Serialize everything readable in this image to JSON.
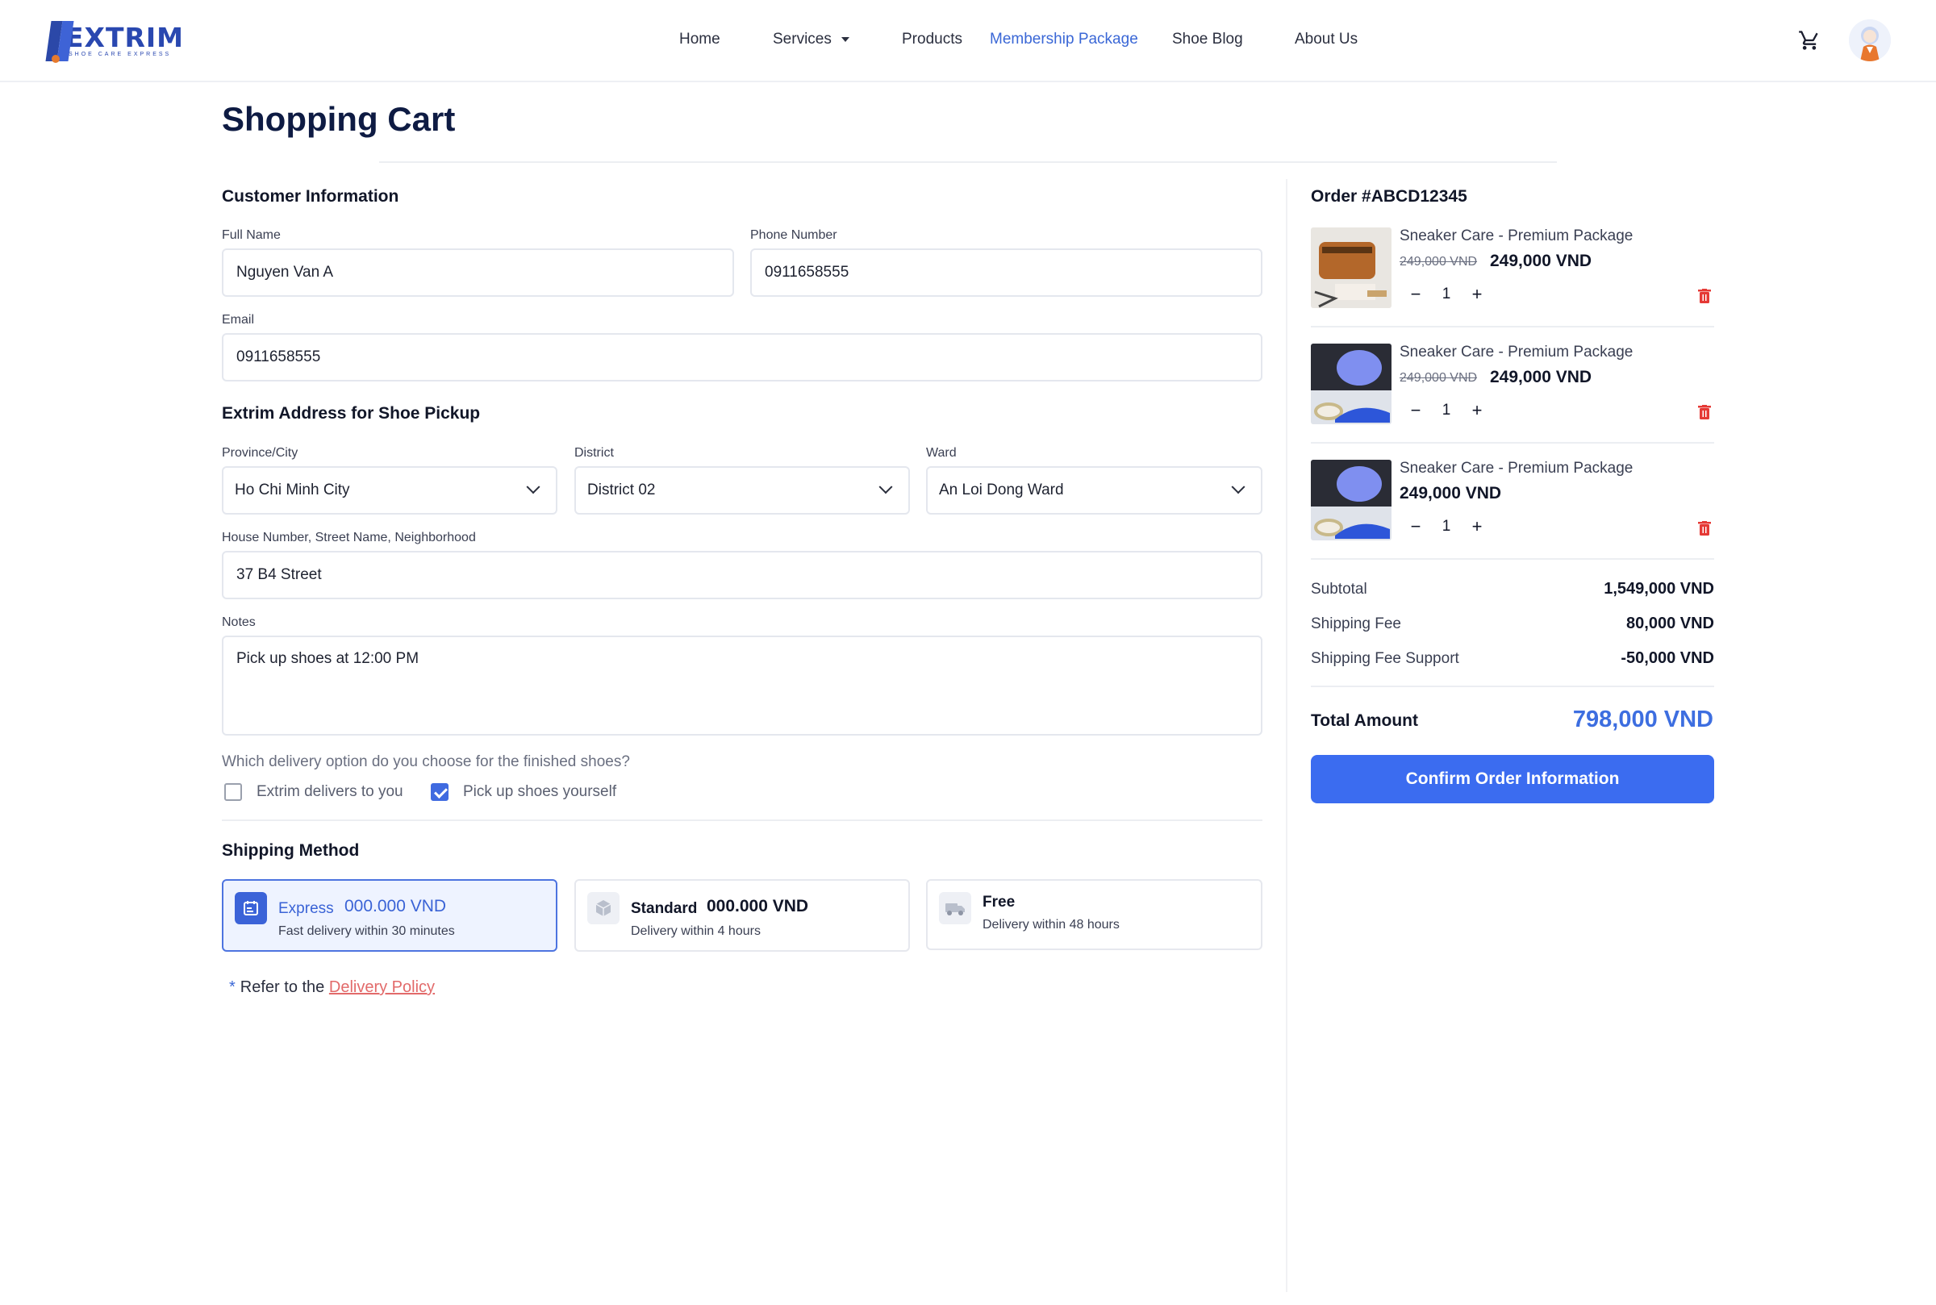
{
  "header": {
    "logo_text": "EXTRIM",
    "logo_tagline": "SHOE CARE EXPRESS",
    "nav": {
      "home": "Home",
      "services": "Services",
      "products": "Products",
      "membership": "Membership Package",
      "blog": "Shoe Blog",
      "about": "About Us"
    },
    "active_nav": "Membership Package"
  },
  "page_title": "Shopping Cart",
  "customer": {
    "section_title": "Customer Information",
    "full_name_label": "Full Name",
    "full_name_value": "Nguyen Van A",
    "phone_label": "Phone Number",
    "phone_value": "0911658555",
    "email_label": "Email",
    "email_value": "0911658555"
  },
  "address": {
    "section_title": "Extrim Address for Shoe Pickup",
    "province_label": "Province/City",
    "province_value": "Ho Chi Minh City",
    "district_label": "District",
    "district_value": "District 02",
    "ward_label": "Ward",
    "ward_value": "An Loi Dong Ward",
    "street_label": "House Number, Street Name, Neighborhood",
    "street_value": "37 B4 Street",
    "notes_label": "Notes",
    "notes_value": "Pick up shoes at 12:00 PM"
  },
  "delivery": {
    "question": "Which delivery option do you choose for the finished shoes?",
    "option_deliver": "Extrim delivers to you",
    "option_deliver_checked": false,
    "option_pickup": "Pick up shoes yourself",
    "option_pickup_checked": true
  },
  "shipping": {
    "section_title": "Shipping Method",
    "express": {
      "name": "Express",
      "price": "000.000 VND",
      "desc": "Fast delivery within 30 minutes",
      "selected": true
    },
    "standard": {
      "name": "Standard",
      "price": "000.000 VND",
      "desc": "Delivery within 4 hours"
    },
    "free": {
      "name": "Free",
      "desc": "Delivery within 48 hours"
    },
    "policy_prefix": "Refer to the",
    "policy_link": "Delivery Policy"
  },
  "order": {
    "title": "Order #ABCD12345",
    "items": [
      {
        "name": "Sneaker Care - Premium Package",
        "old_price": "249,000 VND",
        "price": "249,000 VND",
        "qty": "1"
      },
      {
        "name": "Sneaker Care - Premium Package",
        "old_price": "249,000 VND",
        "price": "249,000 VND",
        "qty": "1"
      },
      {
        "name": "Sneaker Care - Premium Package",
        "price": "249,000 VND",
        "qty": "1"
      }
    ],
    "subtotal_label": "Subtotal",
    "subtotal_value": "1,549,000 VND",
    "shipping_fee_label": "Shipping Fee",
    "shipping_fee_value": "80,000 VND",
    "support_label": "Shipping Fee Support",
    "support_value": "-50,000 VND",
    "total_label": "Total Amount",
    "total_value": "798,000 VND",
    "confirm_label": "Confirm Order Information"
  },
  "colors": {
    "accent": "#3b6cf0",
    "link_red": "#e26a6a",
    "trash_red": "#e53935",
    "title_navy": "#0e1b43"
  }
}
